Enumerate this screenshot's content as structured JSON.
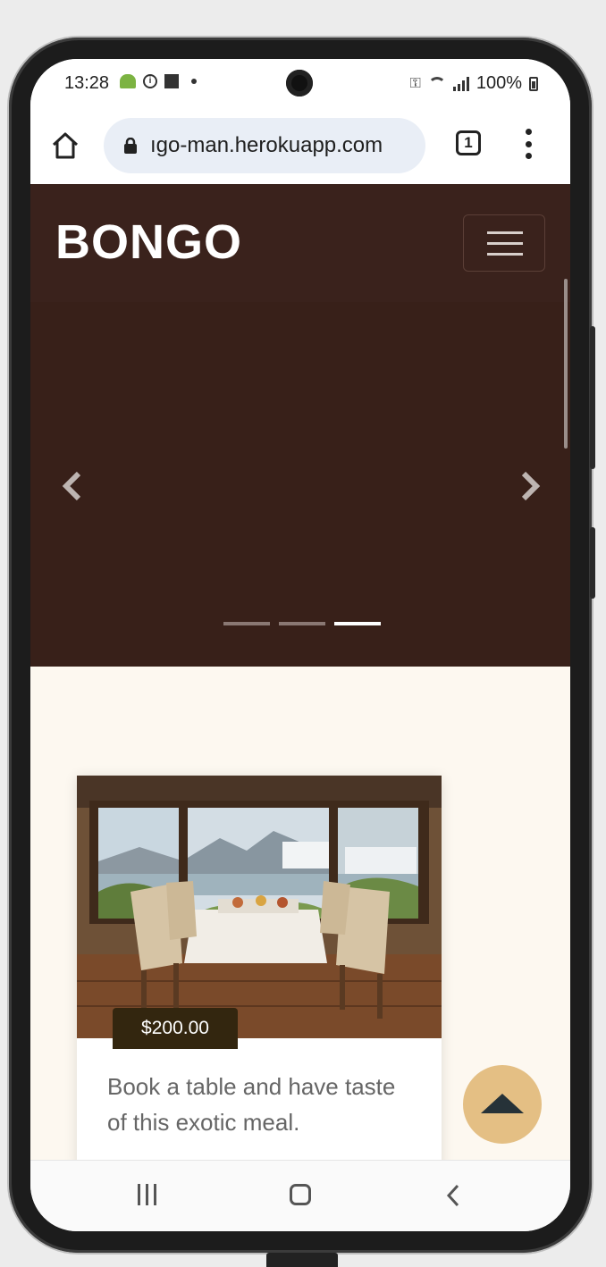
{
  "status_bar": {
    "time": "13:28",
    "battery": "100%"
  },
  "browser": {
    "url": "ıgo-man.herokuapp.com",
    "tab_count": "1"
  },
  "site": {
    "brand": "BONGO",
    "carousel": {
      "slide_count": 3,
      "active_index": 2
    },
    "card": {
      "price": "$200.00",
      "text": "Book a table and have taste of this exotic meal."
    }
  },
  "colors": {
    "navbar_bg": "#3a221c",
    "content_bg": "#fdf8f0",
    "badge_bg": "#33260f",
    "scroll_top_bg": "#e4bf84"
  },
  "icons": [
    "home-icon",
    "lock-icon",
    "tabs-icon",
    "more-vert-icon",
    "hamburger-icon",
    "chevron-left-icon",
    "chevron-right-icon",
    "arrow-up-icon",
    "recent-apps-icon",
    "nav-home-icon",
    "nav-back-icon"
  ]
}
